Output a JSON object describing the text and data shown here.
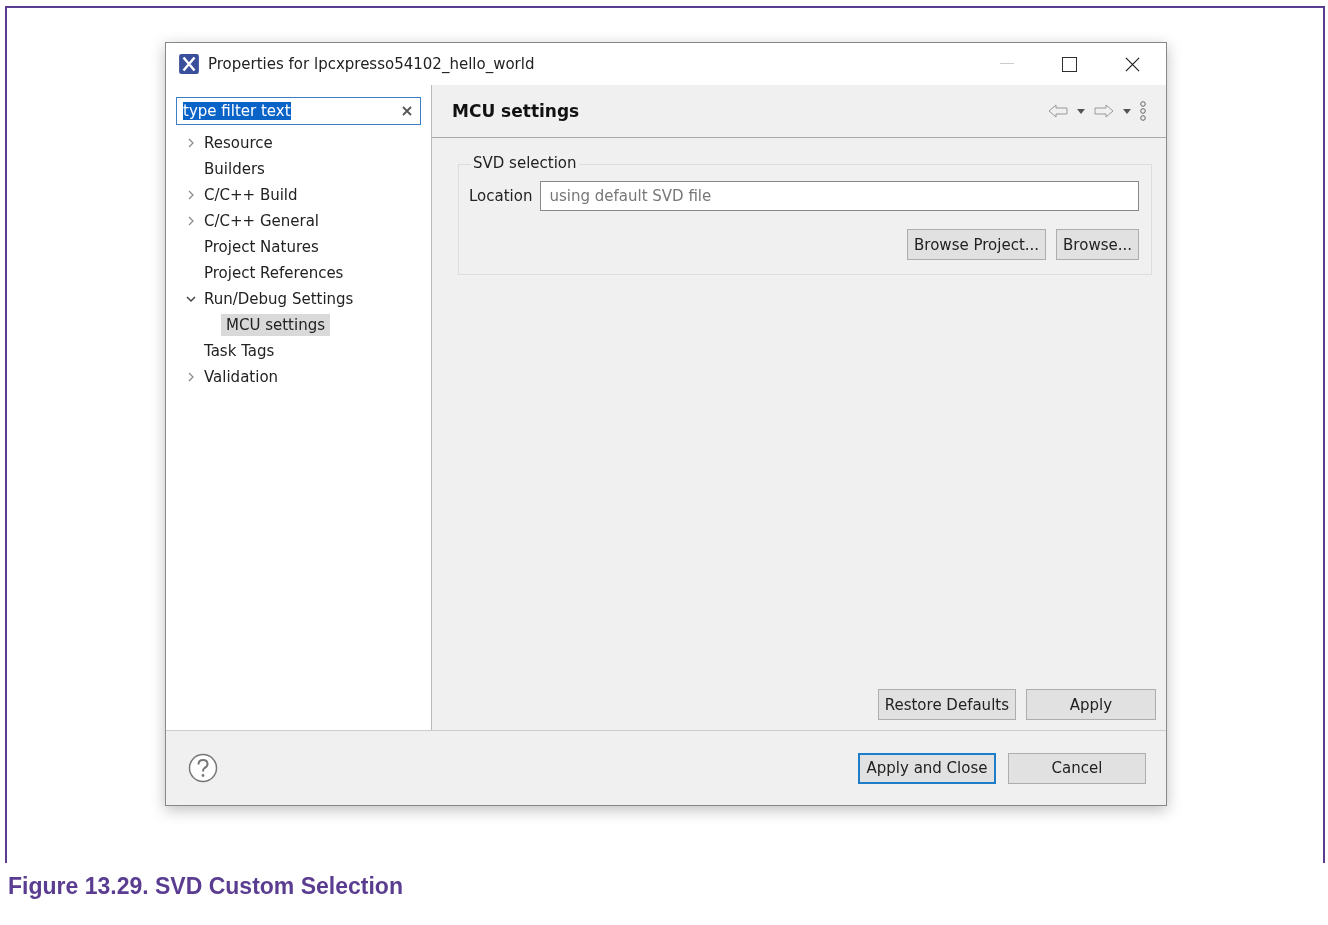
{
  "window": {
    "title": "Properties for lpcxpresso54102_hello_world"
  },
  "filter": {
    "value": "type filter text",
    "text_selected": true
  },
  "tree": [
    {
      "label": "Resource",
      "expandable": true,
      "expanded": false,
      "selected": false
    },
    {
      "label": "Builders",
      "expandable": false,
      "expanded": false,
      "selected": false
    },
    {
      "label": "C/C++ Build",
      "expandable": true,
      "expanded": false,
      "selected": false
    },
    {
      "label": "C/C++ General",
      "expandable": true,
      "expanded": false,
      "selected": false
    },
    {
      "label": "Project Natures",
      "expandable": false,
      "expanded": false,
      "selected": false
    },
    {
      "label": "Project References",
      "expandable": false,
      "expanded": false,
      "selected": false
    },
    {
      "label": "Run/Debug Settings",
      "expandable": true,
      "expanded": true,
      "selected": false,
      "children": [
        {
          "label": "MCU settings",
          "expandable": false,
          "expanded": false,
          "selected": true
        }
      ]
    },
    {
      "label": "Task Tags",
      "expandable": false,
      "expanded": false,
      "selected": false
    },
    {
      "label": "Validation",
      "expandable": true,
      "expanded": false,
      "selected": false
    }
  ],
  "page": {
    "title": "MCU settings",
    "group": {
      "title": "SVD selection",
      "location_label": "Location",
      "location_placeholder": "using default SVD file",
      "buttons": [
        {
          "label": "Browse Project..."
        },
        {
          "label": "Browse..."
        }
      ]
    },
    "buttons": [
      {
        "label": "Restore Defaults"
      },
      {
        "label": "Apply"
      }
    ]
  },
  "footer_buttons": [
    {
      "label": "Apply and Close",
      "default": true
    },
    {
      "label": "Cancel",
      "default": false
    }
  ],
  "caption": "Figure 13.29. SVD Custom Selection"
}
